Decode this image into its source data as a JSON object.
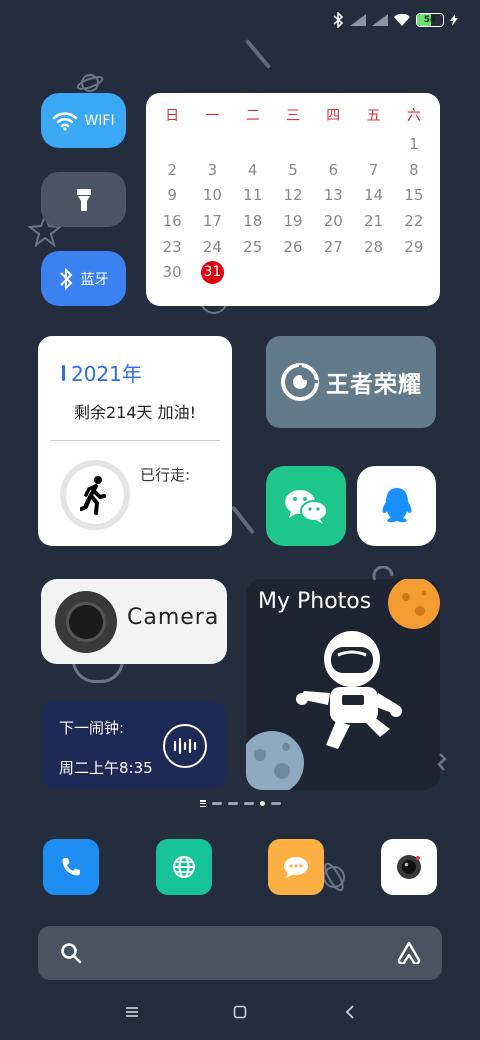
{
  "status_bar": {
    "battery": "54",
    "battery_level": 0.54
  },
  "tiles": {
    "wifi_label": "WIFI",
    "bluetooth_label": "蓝牙"
  },
  "calendar": {
    "weekdays": [
      "日",
      "一",
      "二",
      "三",
      "四",
      "五",
      "六"
    ],
    "days": [
      "",
      "",
      "",
      "",
      "",
      "",
      "1",
      "2",
      "3",
      "4",
      "5",
      "6",
      "7",
      "8",
      "9",
      "10",
      "11",
      "12",
      "13",
      "14",
      "15",
      "16",
      "17",
      "18",
      "19",
      "20",
      "21",
      "22",
      "23",
      "24",
      "25",
      "26",
      "27",
      "28",
      "29",
      "30",
      "31"
    ],
    "today": "31"
  },
  "year_widget": {
    "title": "2021年",
    "remaining": "剩余214天 加油!",
    "walk_label": "已行走:"
  },
  "game": {
    "name": "王者荣耀"
  },
  "camera_widget": {
    "label": "Camera"
  },
  "photos_widget": {
    "title": "My Photos"
  },
  "alarm_widget": {
    "line1": "下一闹钟:",
    "line2": "周二上午8:35"
  },
  "colors": {
    "background": "#232d3d",
    "wifi": "#3aa8f5",
    "bluetooth": "#3b82f0",
    "wechat": "#1ec68c",
    "today": "#e00010"
  },
  "icons": [
    "bluetooth-icon",
    "signal-icon",
    "wifi-icon",
    "battery-icon",
    "flashlight-icon",
    "walk-icon",
    "wechat-icon",
    "qq-icon",
    "phone-icon",
    "browser-icon",
    "messages-icon",
    "camera-icon",
    "search-icon",
    "assistant-icon",
    "menu-icon",
    "home-icon",
    "back-icon"
  ]
}
